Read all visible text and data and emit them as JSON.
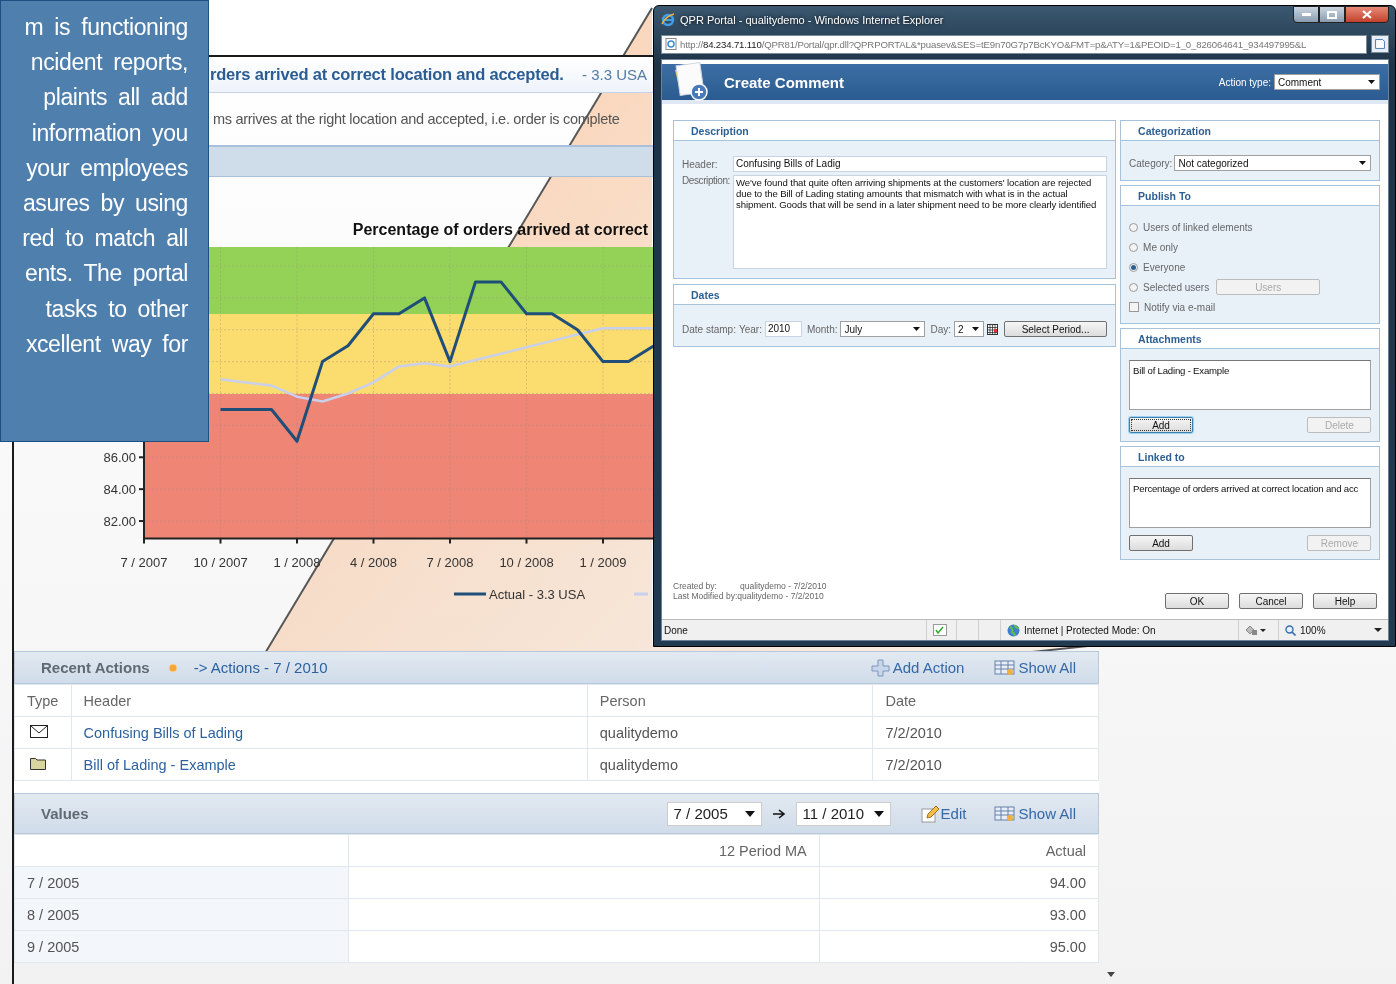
{
  "promo_text": {
    "lines": [
      "m is functioning",
      "ncident reports,",
      "plaints all add",
      "information you",
      "your employees",
      "asures by using",
      "red to match all",
      "ents. The portal",
      "tasks to other",
      "xcellent way for"
    ]
  },
  "kpi_page": {
    "title": "rders arrived at correct location and accepted.",
    "unit": "- 3.3 USA",
    "description": "ms arrives at the right location and accepted, i.e. order is complete",
    "chart_data": {
      "type": "line",
      "title": "Percentage of orders arrived at correct",
      "categories": [
        "7 / 2007",
        null,
        null,
        "10 / 2007",
        null,
        null,
        "1 / 2008",
        null,
        null,
        "4 / 2008",
        null,
        null,
        "7 / 2008",
        null,
        null,
        "10 / 2008",
        null,
        null,
        "1 / 2009",
        null,
        null
      ],
      "series": [
        {
          "name": "Actual - 3.3 USA",
          "color": "#1f4e79",
          "values": [
            null,
            null,
            null,
            89,
            89,
            89,
            87,
            92,
            93,
            95,
            95,
            96,
            92,
            97,
            97,
            95,
            95,
            94,
            92,
            92,
            93
          ]
        },
        {
          "color": "#c8d0ec",
          "values": [
            null,
            null,
            null,
            90.9,
            90.7,
            90.5,
            89.8,
            89.5,
            90.0,
            90.7,
            91.7,
            91.9,
            91.7,
            92.1,
            92.5,
            92.9,
            93.3,
            93.7,
            94.1,
            94.1,
            94.1
          ]
        }
      ],
      "ylim": [
        80.9,
        99.2
      ],
      "yticks": [
        {
          "value": 82,
          "label": "82.00"
        },
        {
          "value": 84,
          "label": "84.00"
        },
        {
          "value": 86,
          "label": "86.00"
        }
      ],
      "grid": true
    },
    "recent_actions": {
      "title": "Recent Actions",
      "link": "-> Actions - 7 / 2010",
      "add_action": "Add Action",
      "show_all": "Show All",
      "columns": [
        "Type",
        "Header",
        "Person",
        "Date"
      ],
      "rows": [
        {
          "kind": "comment",
          "header": "Confusing Bills of Lading",
          "person": "qualitydemo",
          "date": "7/2/2010"
        },
        {
          "kind": "attachment",
          "header": "Bill of Lading - Example",
          "person": "qualitydemo",
          "date": "7/2/2010"
        }
      ]
    },
    "values": {
      "title": "Values",
      "from": "7 / 2005",
      "to": "11 / 2010",
      "edit": "Edit",
      "show_all": "Show All",
      "columns": [
        "12 Period MA",
        "Actual"
      ],
      "rows": [
        {
          "period": "7 / 2005",
          "actual": "94.00"
        },
        {
          "period": "8 / 2005",
          "actual": "93.00"
        },
        {
          "period": "9 / 2005",
          "actual": "95.00"
        }
      ]
    }
  },
  "browser": {
    "title": "QPR Portal - qualitydemo - Windows Internet Explorer",
    "url_scheme": "http://",
    "url_host": "84.234.71.110",
    "url_path": "/QPR81/Portal/qpr.dll?QPRPORTAL&*puasev&SES=tE9n70G7p7BcKYO&FMT=p&ATY=1&PEOID=1_0_826064641_934497995&L",
    "status": "Done",
    "zone": "Internet | Protected Mode: On",
    "zoom": "100%"
  },
  "dialog": {
    "title": "Create Comment",
    "action_type_label": "Action type:",
    "action_type": "Comment",
    "description": {
      "title": "Description",
      "header_label": "Header:",
      "header": "Confusing Bills of Ladig",
      "description_label": "Description:",
      "description": "We've found that quite often arriving shipments at the customers' location are rejected due to the Bill of Lading stating amounts that mismatch with what is in the actual shipment. Goods that will be send in a later shipment need to be more clearly identified"
    },
    "dates": {
      "title": "Dates",
      "stamp_label": "Date stamp:",
      "year_label": "Year:",
      "year": "2010",
      "month_label": "Month:",
      "month": "July",
      "day_label": "Day:",
      "day": "2",
      "select_period": "Select Period..."
    },
    "categorization": {
      "title": "Categorization",
      "category_label": "Category:",
      "category": "Not categorized"
    },
    "publish_to": {
      "title": "Publish To",
      "options": [
        {
          "label": "Users of linked elements",
          "selected": false
        },
        {
          "label": "Me only",
          "selected": false
        },
        {
          "label": "Everyone",
          "selected": true
        },
        {
          "label": "Selected users",
          "selected": false,
          "button": "Users"
        }
      ],
      "notify": {
        "label": "Notify via e-mail",
        "checked": false
      }
    },
    "attachments": {
      "title": "Attachments",
      "items": [
        "Bill of Lading - Example"
      ],
      "buttons": [
        {
          "label": "Add",
          "disabled": false,
          "focused": true
        },
        {
          "label": "Delete",
          "disabled": true,
          "focused": false
        }
      ]
    },
    "linked_to": {
      "title": "Linked to",
      "items": [
        "Percentage of orders arrived at correct location and acc"
      ],
      "buttons": [
        {
          "label": "Add",
          "disabled": false,
          "focused": false
        },
        {
          "label": "Remove",
          "disabled": true,
          "focused": false
        }
      ]
    },
    "created_label": "Created by:",
    "created": "qualitydemo - 7/2/2010",
    "modified_label": "Last Modified by:",
    "modified": "qualitydemo - 7/2/2010",
    "buttons": [
      "OK",
      "Cancel",
      "Help"
    ]
  }
}
